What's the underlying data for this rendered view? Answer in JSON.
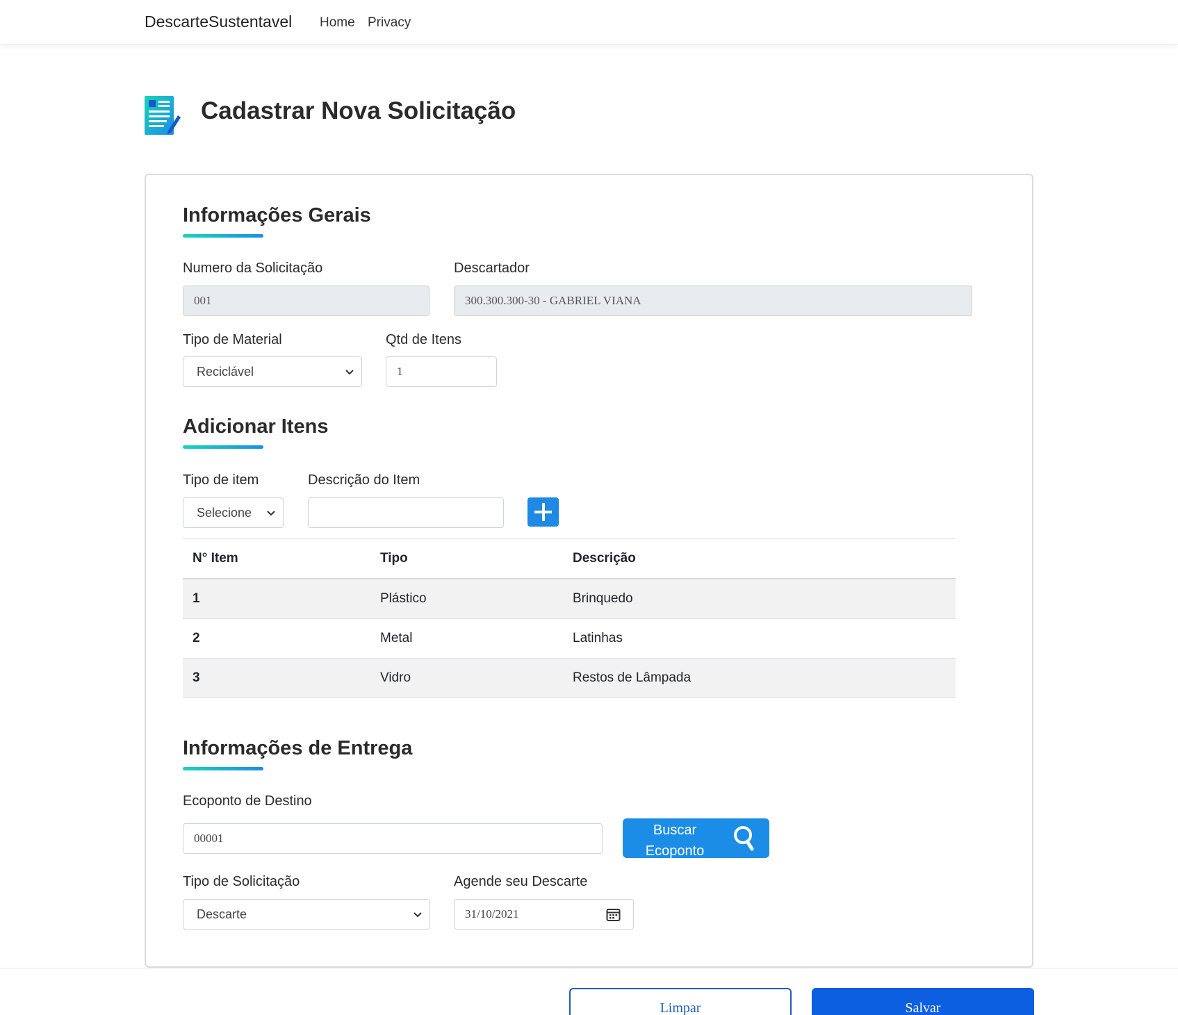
{
  "navbar": {
    "brand": "DescarteSustentavel",
    "links": [
      "Home",
      "Privacy"
    ]
  },
  "page": {
    "title": "Cadastrar Nova Solicitação",
    "icon": "document-edit-icon"
  },
  "general": {
    "section_title": "Informações Gerais",
    "numero_label": "Numero da Solicitação",
    "numero_value": "001",
    "descartador_label": "Descartador",
    "descartador_value": "300.300.300-30 - GABRIEL VIANA",
    "tipo_material_label": "Tipo de Material",
    "tipo_material_value": "Reciclável",
    "qtd_label": "Qtd de Itens",
    "qtd_value": "1"
  },
  "items": {
    "section_title": "Adicionar Itens",
    "tipo_item_label": "Tipo de item",
    "tipo_item_value": "Selecione",
    "descricao_label": "Descrição do Item",
    "descricao_value": "",
    "add_icon": "plus-icon",
    "table": {
      "headers": [
        "N° Item",
        "Tipo",
        "Descrição"
      ],
      "rows": [
        [
          "1",
          "Plástico",
          "Brinquedo"
        ],
        [
          "2",
          "Metal",
          "Latinhas"
        ],
        [
          "3",
          "Vidro",
          "Restos de Lâmpada"
        ]
      ]
    }
  },
  "delivery": {
    "section_title": "Informações de Entrega",
    "ecoponto_label": "Ecoponto de Destino",
    "ecoponto_value": "00001",
    "buscar_line1": "Buscar",
    "buscar_line2": "Ecoponto",
    "buscar_icon": "search-icon",
    "tipo_solicitacao_label": "Tipo de Solicitação",
    "tipo_solicitacao_value": "Descarte",
    "agende_label": "Agende seu Descarte",
    "agende_value": "31/10/2021",
    "calendar_icon": "calendar-icon"
  },
  "actions": {
    "limpar": "Limpar",
    "salvar": "Salvar"
  },
  "colors": {
    "accent_gradient_start": "#17d6b6",
    "accent_gradient_end": "#1a8ee8",
    "primary": "#0b5fe0",
    "button_blue": "#1c8de6"
  }
}
